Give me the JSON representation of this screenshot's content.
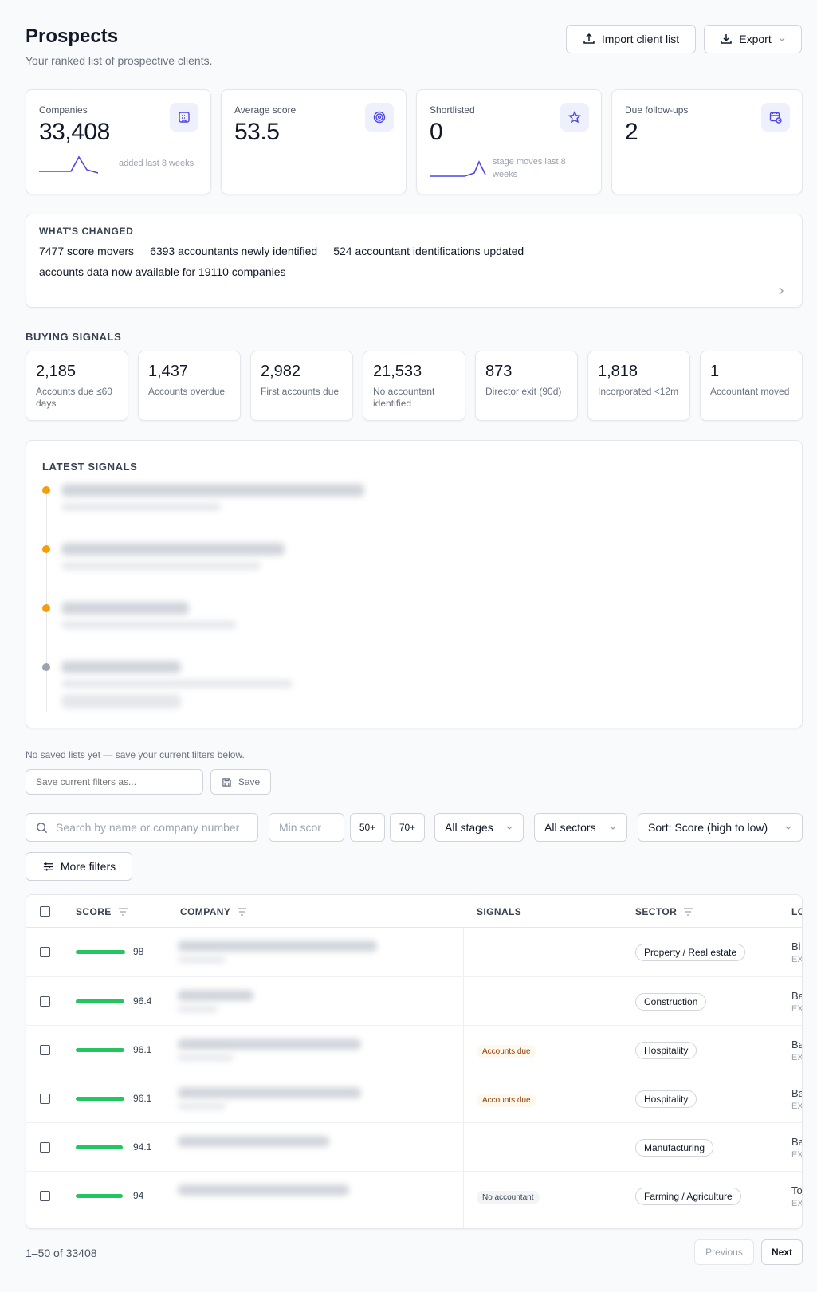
{
  "header": {
    "title": "Prospects",
    "subtitle": "Your ranked list of prospective clients.",
    "import_label": "Import client list",
    "export_label": "Export"
  },
  "kpis": [
    {
      "label": "Companies",
      "value": "33,408",
      "note": "added last 8 weeks",
      "icon": "building-icon"
    },
    {
      "label": "Average score",
      "value": "53.5",
      "note": "",
      "icon": "target-icon"
    },
    {
      "label": "Shortlisted",
      "value": "0",
      "note": "stage moves last 8 weeks",
      "icon": "star-icon"
    },
    {
      "label": "Due follow-ups",
      "value": "2",
      "note": "",
      "icon": "calendar-clock-icon"
    }
  ],
  "changes": {
    "heading": "WHAT'S CHANGED",
    "items": [
      "7477 score movers",
      "6393 accountants newly identified",
      "524 accountant identifications updated",
      "accounts data now available for 19110 companies"
    ]
  },
  "buying_signals": {
    "heading": "BUYING SIGNALS",
    "items": [
      {
        "value": "2,185",
        "label": "Accounts due ≤60 days"
      },
      {
        "value": "1,437",
        "label": "Accounts overdue"
      },
      {
        "value": "2,982",
        "label": "First accounts due"
      },
      {
        "value": "21,533",
        "label": "No accountant identified"
      },
      {
        "value": "873",
        "label": "Director exit (90d)"
      },
      {
        "value": "1,818",
        "label": "Incorporated <12m"
      },
      {
        "value": "1",
        "label": "Accountant moved"
      }
    ]
  },
  "latest_signals": {
    "heading": "LATEST SIGNALS",
    "dot_colors": [
      "#f59e0b",
      "#f59e0b",
      "#f59e0b",
      "#9ca3af"
    ]
  },
  "saved_lists": {
    "empty_text": "No saved lists yet — save your current filters below.",
    "placeholder": "Save current filters as...",
    "save_label": "Save"
  },
  "filters": {
    "search_placeholder": "Search by name or company number",
    "min_score_placeholder": "Min scor",
    "quick_50": "50+",
    "quick_70": "70+",
    "stages": "All stages",
    "sectors": "All sectors",
    "sort": "Sort: Score (high to low)",
    "more_filters": "More filters"
  },
  "table": {
    "columns": {
      "score": "SCORE",
      "company": "COMPANY",
      "signals": "SIGNALS",
      "sector": "SECTOR",
      "location": "LO"
    },
    "rows": [
      {
        "score": 98,
        "score_text": "98",
        "signal": "",
        "sector": "Property / Real estate",
        "loc": "Bi",
        "loc2": "EX"
      },
      {
        "score": 96.4,
        "score_text": "96.4",
        "signal": "",
        "sector": "Construction",
        "loc": "Ba",
        "loc2": "EX"
      },
      {
        "score": 96.1,
        "score_text": "96.1",
        "signal": "Accounts due",
        "sector": "Hospitality",
        "loc": "Ba",
        "loc2": "EX"
      },
      {
        "score": 96.1,
        "score_text": "96.1",
        "signal": "Accounts due",
        "sector": "Hospitality",
        "loc": "Ba",
        "loc2": "EX"
      },
      {
        "score": 94.1,
        "score_text": "94.1",
        "signal": "",
        "sector": "Manufacturing",
        "loc": "Ba",
        "loc2": "EX"
      },
      {
        "score": 94,
        "score_text": "94",
        "signal": "No accountant",
        "sector": "Farming / Agriculture",
        "loc": "To",
        "loc2": "EX"
      }
    ]
  },
  "pagination": {
    "range": "1–50 of 33408",
    "previous": "Previous",
    "next": "Next"
  },
  "colors": {
    "accent": "#4f46e5",
    "score_bar": "#22c55e"
  }
}
